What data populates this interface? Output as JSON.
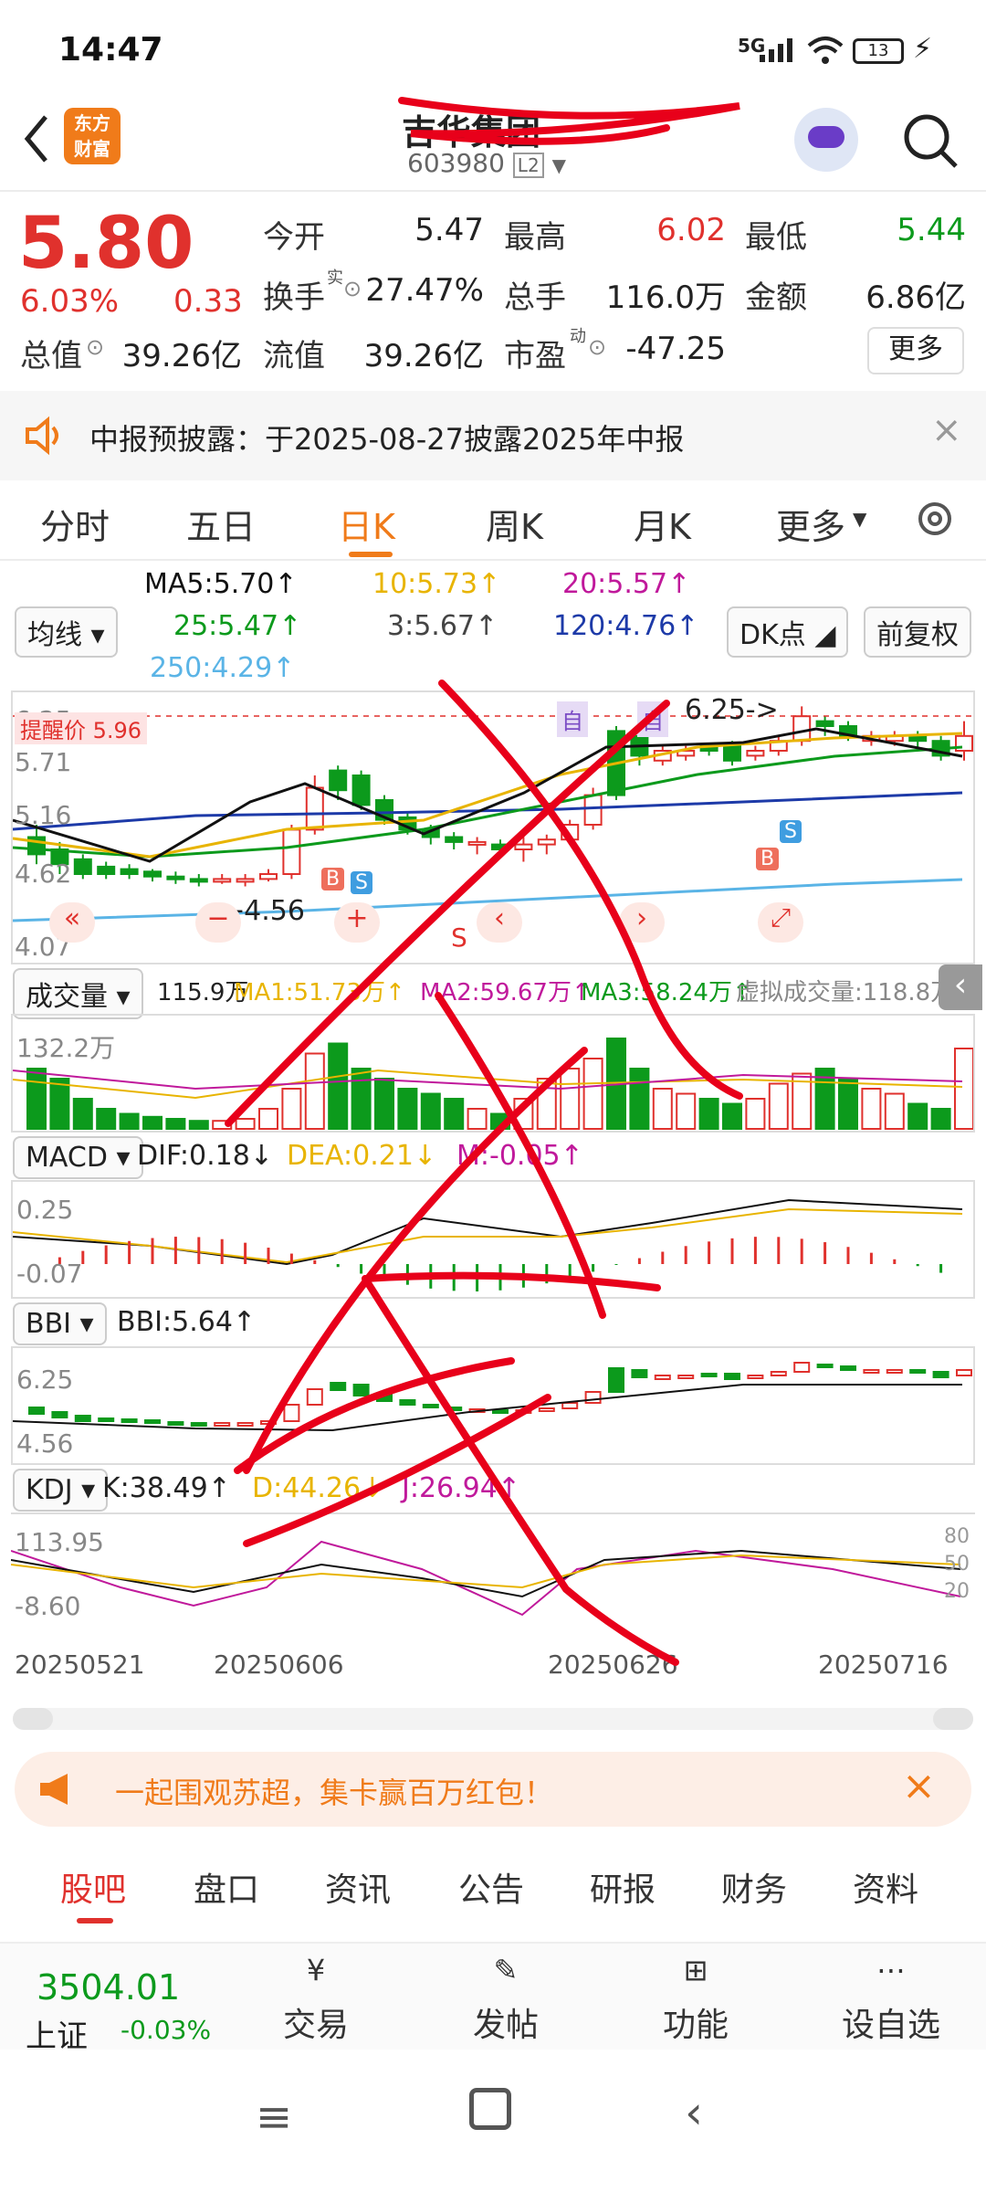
{
  "status": {
    "time": "14:47",
    "network": "5G",
    "battery": "13"
  },
  "header": {
    "stock_name": "吉华集团",
    "stock_code": "603980",
    "level": "L2",
    "logo_text_top": "东方",
    "logo_text_bottom": "财富"
  },
  "quote": {
    "price": "5.80",
    "change_pct": "6.03%",
    "change_abs": "0.33",
    "fields": [
      {
        "label": "今开",
        "value": "5.47",
        "tone": "dark"
      },
      {
        "label": "最高",
        "value": "6.02",
        "tone": "red"
      },
      {
        "label": "最低",
        "value": "5.44",
        "tone": "green"
      },
      {
        "label": "换手",
        "value": "27.47%",
        "tone": "dark",
        "sup": "实"
      },
      {
        "label": "总手",
        "value": "116.0万",
        "tone": "dark"
      },
      {
        "label": "金额",
        "value": "6.86亿",
        "tone": "dark"
      },
      {
        "label": "总值",
        "value": "39.26亿",
        "tone": "dark"
      },
      {
        "label": "流值",
        "value": "39.26亿",
        "tone": "dark"
      },
      {
        "label": "市盈",
        "value": "-47.25",
        "tone": "dark",
        "sup": "动"
      }
    ],
    "more_label": "更多"
  },
  "notice": {
    "text": "中报预披露：于2025-08-27披露2025年中报"
  },
  "chart_tabs": {
    "items": [
      "分时",
      "五日",
      "日K",
      "周K",
      "月K",
      "更多"
    ],
    "active": "日K"
  },
  "ma": {
    "ma5": "MA5:5.70↑",
    "ma10": "10:5.73↑",
    "ma20": "20:5.57↑",
    "ma25": "25:5.47↑",
    "ma3": "3:5.67↑",
    "ma120": "120:4.76↑",
    "ma250": "250:4.29↑",
    "junxian_label": "均线",
    "dk_label": "DK点",
    "fuquan_label": "前复权"
  },
  "kline": {
    "ticks": [
      "6.25",
      "5.71",
      "5.16",
      "4.62",
      "4.07"
    ],
    "alert_label": "提醒价 5.96",
    "high_annot": "6.25->",
    "low_annot": "←4.56",
    "markers": [
      "自",
      "自",
      "B",
      "S",
      "B",
      "S",
      "S"
    ]
  },
  "volume": {
    "title": "成交量",
    "value": "115.9万",
    "ma1": "MA1:51.73万↑",
    "ma2": "MA2:59.67万↑",
    "ma3": "MA3:58.24万↑",
    "virtual": "虚拟成交量:118.8万",
    "tick": "132.2万"
  },
  "macd": {
    "title": "MACD",
    "dif": "DIF:0.18↓",
    "dea": "DEA:0.21↓",
    "m": "M:-0.05↑",
    "tick_top": "0.25",
    "tick_bottom": "-0.07"
  },
  "bbi": {
    "title": "BBI",
    "value": "BBI:5.64↑",
    "tick_top": "6.25",
    "tick_bottom": "4.56"
  },
  "kdj": {
    "title": "KDJ",
    "k": "K:38.49↑",
    "d": "D:44.26↓",
    "j": "J:26.94↑",
    "tick_top": "113.95",
    "tick_bottom": "-8.60",
    "levels": [
      "80",
      "50",
      "20"
    ]
  },
  "dates": [
    "20250521",
    "20250606",
    "20250626",
    "20250716"
  ],
  "promo": {
    "text": "一起围观苏超，集卡赢百万红包！"
  },
  "bottom_tabs": [
    "股吧",
    "盘口",
    "资讯",
    "公告",
    "研报",
    "财务",
    "资料"
  ],
  "dock": {
    "index_value": "3504.01",
    "index_name": "上证",
    "index_change": "-0.03%",
    "items": [
      {
        "label": "交易",
        "icon": "yen-icon"
      },
      {
        "label": "发帖",
        "icon": "edit-icon"
      },
      {
        "label": "功能",
        "icon": "grid-icon"
      },
      {
        "label": "设自选",
        "icon": "more-icon"
      }
    ]
  },
  "colors": {
    "up": "#e0312d",
    "down": "#0c9a1c",
    "accent": "#f07b1a"
  }
}
